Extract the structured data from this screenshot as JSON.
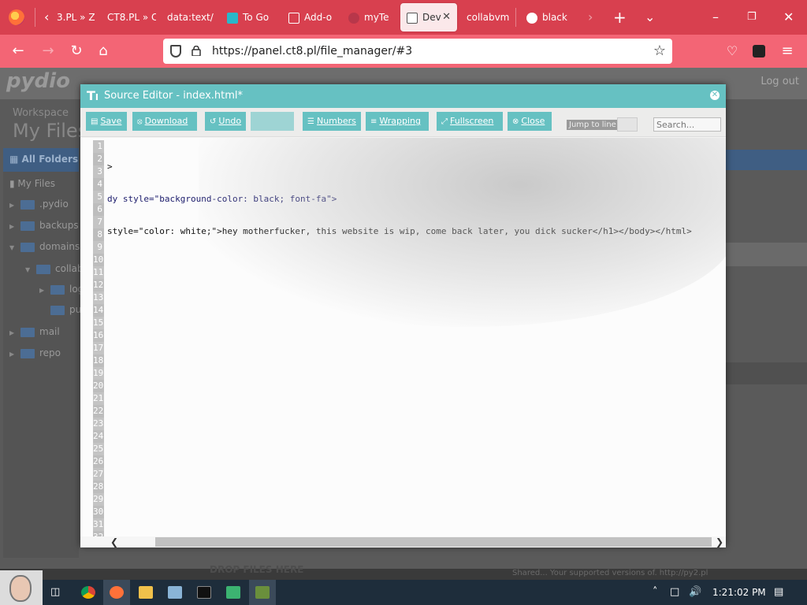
{
  "browser": {
    "tabs": [
      {
        "label": "3.PL » Z"
      },
      {
        "label": "CT8.PL » C"
      },
      {
        "label": "data:text/"
      },
      {
        "label": "To Go"
      },
      {
        "label": "Add-o"
      },
      {
        "label": "myTe"
      },
      {
        "label": "Dev",
        "active": true
      },
      {
        "label": "collabvm"
      },
      {
        "label": "black"
      }
    ],
    "url": "https://panel.ct8.pl/file_manager/#3",
    "accent_color": "#d8404f",
    "nav_color": "#f36575"
  },
  "page": {
    "logo": "pydio",
    "logout": "Log out",
    "workspace_label": "Workspace",
    "title": "My Files",
    "all_folders": "All Folders",
    "tree": [
      {
        "label": "My Files"
      },
      {
        "label": ".pydio"
      },
      {
        "label": "backups"
      },
      {
        "label": "domains"
      },
      {
        "label": "collab"
      },
      {
        "label": "log"
      },
      {
        "label": "pu"
      },
      {
        "label": "mail"
      },
      {
        "label": "repo"
      }
    ],
    "drop_files": "DROP FILES HERE",
    "footer_note": "Shared... Your supported versions of. http://py2.pl"
  },
  "editor": {
    "title": "Source Editor - index.html*",
    "accent_color": "#66c1c2",
    "toolbar": {
      "save": "Save",
      "download": "Download",
      "undo": "Undo",
      "redo": "",
      "numbers": "Numbers",
      "wrapping": "Wrapping",
      "fullscreen": "Fullscreen",
      "close": "Close",
      "jump_to_line": "Jump to line",
      "search_placeholder": "Search..."
    },
    "lines": [
      ">",
      "dy style=\"background-color: black; font-fa\">",
      "style=\"color: white;\">hey motherfucker, this website is wip, come back later, you dick sucker</h1></body></html>"
    ],
    "line_numbers": [
      "1",
      "2",
      "3",
      "4",
      "5",
      "6",
      "7",
      "8",
      "9",
      "10",
      "11",
      "12",
      "13",
      "14",
      "15",
      "16",
      "17",
      "18",
      "19",
      "20",
      "21",
      "22",
      "23",
      "24",
      "25",
      "26",
      "27",
      "28",
      "29",
      "30",
      "31",
      "32"
    ]
  },
  "taskbar": {
    "clock": "1:21:02 PM"
  }
}
